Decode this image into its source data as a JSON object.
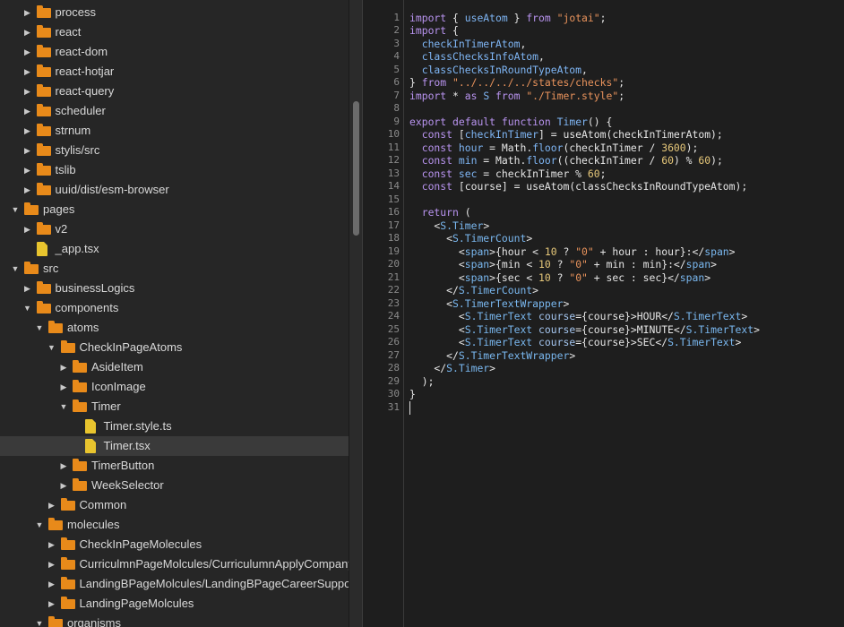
{
  "tree": [
    {
      "name": "process",
      "type": "folder",
      "depth": 1,
      "expanded": false
    },
    {
      "name": "react",
      "type": "folder",
      "depth": 1,
      "expanded": false
    },
    {
      "name": "react-dom",
      "type": "folder",
      "depth": 1,
      "expanded": false
    },
    {
      "name": "react-hotjar",
      "type": "folder",
      "depth": 1,
      "expanded": false
    },
    {
      "name": "react-query",
      "type": "folder",
      "depth": 1,
      "expanded": false
    },
    {
      "name": "scheduler",
      "type": "folder",
      "depth": 1,
      "expanded": false
    },
    {
      "name": "strnum",
      "type": "folder",
      "depth": 1,
      "expanded": false
    },
    {
      "name": "stylis/src",
      "type": "folder",
      "depth": 1,
      "expanded": false
    },
    {
      "name": "tslib",
      "type": "folder",
      "depth": 1,
      "expanded": false
    },
    {
      "name": "uuid/dist/esm-browser",
      "type": "folder",
      "depth": 1,
      "expanded": false
    },
    {
      "name": "pages",
      "type": "folder",
      "depth": 0,
      "expanded": true
    },
    {
      "name": "v2",
      "type": "folder",
      "depth": 1,
      "expanded": false
    },
    {
      "name": "_app.tsx",
      "type": "file",
      "depth": 1
    },
    {
      "name": "src",
      "type": "folder",
      "depth": 0,
      "expanded": true
    },
    {
      "name": "businessLogics",
      "type": "folder",
      "depth": 1,
      "expanded": false
    },
    {
      "name": "components",
      "type": "folder",
      "depth": 1,
      "expanded": true
    },
    {
      "name": "atoms",
      "type": "folder",
      "depth": 2,
      "expanded": true
    },
    {
      "name": "CheckInPageAtoms",
      "type": "folder",
      "depth": 3,
      "expanded": true
    },
    {
      "name": "AsideItem",
      "type": "folder",
      "depth": 4,
      "expanded": false
    },
    {
      "name": "IconImage",
      "type": "folder",
      "depth": 4,
      "expanded": false
    },
    {
      "name": "Timer",
      "type": "folder",
      "depth": 4,
      "expanded": true
    },
    {
      "name": "Timer.style.ts",
      "type": "file",
      "depth": 5
    },
    {
      "name": "Timer.tsx",
      "type": "file",
      "depth": 5,
      "selected": true
    },
    {
      "name": "TimerButton",
      "type": "folder",
      "depth": 4,
      "expanded": false
    },
    {
      "name": "WeekSelector",
      "type": "folder",
      "depth": 4,
      "expanded": false
    },
    {
      "name": "Common",
      "type": "folder",
      "depth": 3,
      "expanded": false
    },
    {
      "name": "molecules",
      "type": "folder",
      "depth": 2,
      "expanded": true
    },
    {
      "name": "CheckInPageMolecules",
      "type": "folder",
      "depth": 3,
      "expanded": false
    },
    {
      "name": "CurriculmnPageMolcules/CurriculumnApplyCompany",
      "type": "folder",
      "depth": 3,
      "expanded": false
    },
    {
      "name": "LandingBPageMolcules/LandingBPageCareerSuppor",
      "type": "folder",
      "depth": 3,
      "expanded": false
    },
    {
      "name": "LandingPageMolcules",
      "type": "folder",
      "depth": 3,
      "expanded": false
    },
    {
      "name": "organisms",
      "type": "folder",
      "depth": 2,
      "expanded": true
    }
  ],
  "editor": {
    "file": "Timer.tsx",
    "lines": [
      [
        [
          "kw",
          "import"
        ],
        [
          "op",
          " { "
        ],
        [
          "fn",
          "useAtom"
        ],
        [
          "op",
          " } "
        ],
        [
          "kw",
          "from"
        ],
        [
          "op",
          " "
        ],
        [
          "str",
          "\"jotai\""
        ],
        [
          "op",
          ";"
        ]
      ],
      [
        [
          "kw",
          "import"
        ],
        [
          "op",
          " {"
        ]
      ],
      [
        [
          "op",
          "  "
        ],
        [
          "fn",
          "checkInTimerAtom"
        ],
        [
          "op",
          ","
        ]
      ],
      [
        [
          "op",
          "  "
        ],
        [
          "fn",
          "classChecksInfoAtom"
        ],
        [
          "op",
          ","
        ]
      ],
      [
        [
          "op",
          "  "
        ],
        [
          "fn",
          "classChecksInRoundTypeAtom"
        ],
        [
          "op",
          ","
        ]
      ],
      [
        [
          "op",
          "} "
        ],
        [
          "kw",
          "from"
        ],
        [
          "op",
          " "
        ],
        [
          "str",
          "\"../../../../states/checks\""
        ],
        [
          "op",
          ";"
        ]
      ],
      [
        [
          "kw",
          "import"
        ],
        [
          "op",
          " * "
        ],
        [
          "kw",
          "as"
        ],
        [
          "op",
          " "
        ],
        [
          "fn",
          "S"
        ],
        [
          "op",
          " "
        ],
        [
          "kw",
          "from"
        ],
        [
          "op",
          " "
        ],
        [
          "str",
          "\"./Timer.style\""
        ],
        [
          "op",
          ";"
        ]
      ],
      [],
      [
        [
          "kw",
          "export"
        ],
        [
          "op",
          " "
        ],
        [
          "kw",
          "default"
        ],
        [
          "op",
          " "
        ],
        [
          "kw",
          "function"
        ],
        [
          "op",
          " "
        ],
        [
          "fn",
          "Timer"
        ],
        [
          "op",
          "() {"
        ]
      ],
      [
        [
          "op",
          "  "
        ],
        [
          "kw",
          "const"
        ],
        [
          "op",
          " ["
        ],
        [
          "fn",
          "checkInTimer"
        ],
        [
          "op",
          "] = useAtom(checkInTimerAtom);"
        ]
      ],
      [
        [
          "op",
          "  "
        ],
        [
          "kw",
          "const"
        ],
        [
          "op",
          " "
        ],
        [
          "fn",
          "hour"
        ],
        [
          "op",
          " = Math."
        ],
        [
          "fn",
          "floor"
        ],
        [
          "op",
          "(checkInTimer / "
        ],
        [
          "num",
          "3600"
        ],
        [
          "op",
          ");"
        ]
      ],
      [
        [
          "op",
          "  "
        ],
        [
          "kw",
          "const"
        ],
        [
          "op",
          " "
        ],
        [
          "fn",
          "min"
        ],
        [
          "op",
          " = Math."
        ],
        [
          "fn",
          "floor"
        ],
        [
          "op",
          "((checkInTimer / "
        ],
        [
          "num",
          "60"
        ],
        [
          "op",
          ") % "
        ],
        [
          "num",
          "60"
        ],
        [
          "op",
          ");"
        ]
      ],
      [
        [
          "op",
          "  "
        ],
        [
          "kw",
          "const"
        ],
        [
          "op",
          " "
        ],
        [
          "fn",
          "sec"
        ],
        [
          "op",
          " = checkInTimer % "
        ],
        [
          "num",
          "60"
        ],
        [
          "op",
          ";"
        ]
      ],
      [
        [
          "op",
          "  "
        ],
        [
          "kw",
          "const"
        ],
        [
          "op",
          " [course] = useAtom(classChecksInRoundTypeAtom);"
        ]
      ],
      [],
      [
        [
          "op",
          "  "
        ],
        [
          "kw",
          "return"
        ],
        [
          "op",
          " ("
        ]
      ],
      [
        [
          "op",
          "    <"
        ],
        [
          "tag",
          "S.Timer"
        ],
        [
          "op",
          ">"
        ]
      ],
      [
        [
          "op",
          "      <"
        ],
        [
          "tag",
          "S.TimerCount"
        ],
        [
          "op",
          ">"
        ]
      ],
      [
        [
          "op",
          "        <"
        ],
        [
          "tag",
          "span"
        ],
        [
          "op",
          ">{hour < "
        ],
        [
          "num",
          "10"
        ],
        [
          "op",
          " ? "
        ],
        [
          "str",
          "\"0\""
        ],
        [
          "op",
          " + hour : hour}:</"
        ],
        [
          "tag",
          "span"
        ],
        [
          "op",
          ">"
        ]
      ],
      [
        [
          "op",
          "        <"
        ],
        [
          "tag",
          "span"
        ],
        [
          "op",
          ">{min < "
        ],
        [
          "num",
          "10"
        ],
        [
          "op",
          " ? "
        ],
        [
          "str",
          "\"0\""
        ],
        [
          "op",
          " + min : min}:</"
        ],
        [
          "tag",
          "span"
        ],
        [
          "op",
          ">"
        ]
      ],
      [
        [
          "op",
          "        <"
        ],
        [
          "tag",
          "span"
        ],
        [
          "op",
          ">{sec < "
        ],
        [
          "num",
          "10"
        ],
        [
          "op",
          " ? "
        ],
        [
          "str",
          "\"0\""
        ],
        [
          "op",
          " + sec : sec}</"
        ],
        [
          "tag",
          "span"
        ],
        [
          "op",
          ">"
        ]
      ],
      [
        [
          "op",
          "      </"
        ],
        [
          "tag",
          "S.TimerCount"
        ],
        [
          "op",
          ">"
        ]
      ],
      [
        [
          "op",
          "      <"
        ],
        [
          "tag",
          "S.TimerTextWrapper"
        ],
        [
          "op",
          ">"
        ]
      ],
      [
        [
          "op",
          "        <"
        ],
        [
          "tag",
          "S.TimerText"
        ],
        [
          "op",
          " "
        ],
        [
          "attr",
          "course"
        ],
        [
          "op",
          "={course}>HOUR</"
        ],
        [
          "tag",
          "S.TimerText"
        ],
        [
          "op",
          ">"
        ]
      ],
      [
        [
          "op",
          "        <"
        ],
        [
          "tag",
          "S.TimerText"
        ],
        [
          "op",
          " "
        ],
        [
          "attr",
          "course"
        ],
        [
          "op",
          "={course}>MINUTE</"
        ],
        [
          "tag",
          "S.TimerText"
        ],
        [
          "op",
          ">"
        ]
      ],
      [
        [
          "op",
          "        <"
        ],
        [
          "tag",
          "S.TimerText"
        ],
        [
          "op",
          " "
        ],
        [
          "attr",
          "course"
        ],
        [
          "op",
          "={course}>SEC</"
        ],
        [
          "tag",
          "S.TimerText"
        ],
        [
          "op",
          ">"
        ]
      ],
      [
        [
          "op",
          "      </"
        ],
        [
          "tag",
          "S.TimerTextWrapper"
        ],
        [
          "op",
          ">"
        ]
      ],
      [
        [
          "op",
          "    </"
        ],
        [
          "tag",
          "S.Timer"
        ],
        [
          "op",
          ">"
        ]
      ],
      [
        [
          "op",
          "  );"
        ]
      ],
      [
        [
          "op",
          "}"
        ]
      ],
      []
    ]
  },
  "colors": {
    "folder": "#e88a1a",
    "file": "#e8c42e",
    "keyword": "#b994f0",
    "string": "#e9935c",
    "identifier": "#7fb6f5",
    "number": "#e7c87a"
  }
}
